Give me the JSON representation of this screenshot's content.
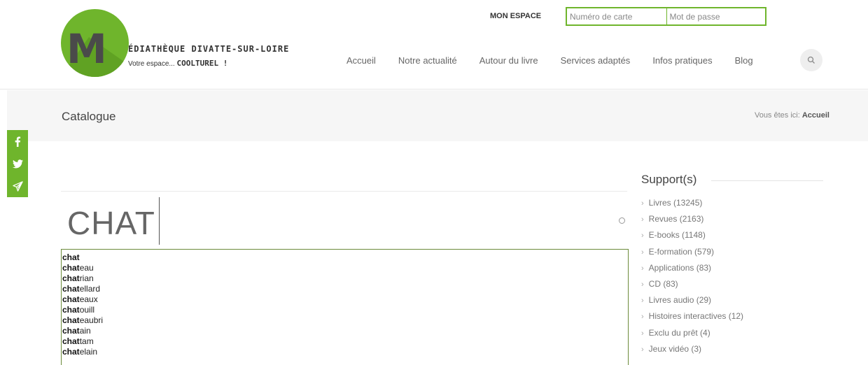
{
  "header": {
    "logo": {
      "letter": "M",
      "name": "ÉDIATHÈQUE DIVATTE-SUR-LOIRE",
      "tagline_prefix": "Votre espace...",
      "tagline_bold": "COOLTUREL !"
    },
    "mon_espace": "MON ESPACE",
    "login": {
      "card_placeholder": "Numéro de carte",
      "password_placeholder": "Mot de passe"
    },
    "nav": [
      {
        "label": "Accueil"
      },
      {
        "label": "Notre actualité"
      },
      {
        "label": "Autour du livre"
      },
      {
        "label": "Services adaptés"
      },
      {
        "label": "Infos pratiques"
      },
      {
        "label": "Blog"
      }
    ],
    "search_icon": "search-icon"
  },
  "titlebar": {
    "title": "Catalogue",
    "breadcrumb_prefix": "Vous êtes ici:",
    "breadcrumb_current": "Accueil"
  },
  "social": [
    {
      "icon": "facebook-icon",
      "glyph": "f"
    },
    {
      "icon": "twitter-icon",
      "glyph": "🐦"
    },
    {
      "icon": "send-icon",
      "glyph": "✈"
    }
  ],
  "search": {
    "value": "CHAT",
    "suggestions": [
      {
        "bold": "chat",
        "rest": ""
      },
      {
        "bold": "chat",
        "rest": "eau"
      },
      {
        "bold": "chat",
        "rest": "rian"
      },
      {
        "bold": "chat",
        "rest": "ellard"
      },
      {
        "bold": "chat",
        "rest": "eaux"
      },
      {
        "bold": "chat",
        "rest": "ouill"
      },
      {
        "bold": "chat",
        "rest": "eaubri"
      },
      {
        "bold": "chat",
        "rest": "ain"
      },
      {
        "bold": "chat",
        "rest": "tam"
      },
      {
        "bold": "chat",
        "rest": "elain"
      }
    ]
  },
  "sidebar": {
    "title": "Support(s)",
    "items": [
      {
        "label": "Livres (13245)"
      },
      {
        "label": "Revues (2163)"
      },
      {
        "label": "E-books (1148)"
      },
      {
        "label": "E-formation (579)"
      },
      {
        "label": "Applications (83)"
      },
      {
        "label": "CD (83)"
      },
      {
        "label": "Livres audio (29)"
      },
      {
        "label": "Histoires interactives (12)"
      },
      {
        "label": "Exclu du prêt (4)"
      },
      {
        "label": "Jeux vidéo (3)"
      }
    ]
  },
  "colors": {
    "accent": "#6fb52c",
    "suggest_border": "#6b8a3a",
    "titlebar_bg": "#f6f6f6"
  }
}
